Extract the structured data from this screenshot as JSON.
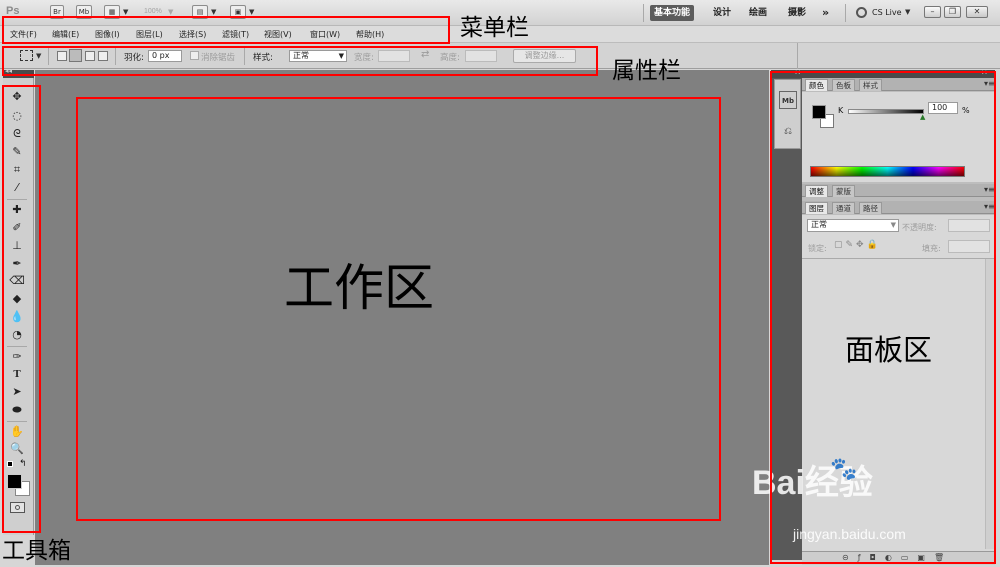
{
  "app": {
    "logo": "Ps",
    "toolbar_buttons": [
      "Br",
      "Mb"
    ],
    "zoom": "100%",
    "workspaces": [
      "基本功能",
      "设计",
      "绘画",
      "摄影"
    ],
    "more": "»",
    "cs_live": "CS Live"
  },
  "menu": [
    "文件(F)",
    "编辑(E)",
    "图像(I)",
    "图层(L)",
    "选择(S)",
    "滤镜(T)",
    "视图(V)",
    "窗口(W)",
    "帮助(H)"
  ],
  "options": {
    "feather_label": "羽化:",
    "feather_value": "0 px",
    "antialias_label": "消除锯齿",
    "style_label": "样式:",
    "style_value": "正常",
    "width_label": "宽度:",
    "height_label": "高度:",
    "refine_edge": "调整边缘..."
  },
  "panels": {
    "group1_tabs": [
      "颜色",
      "色板",
      "样式"
    ],
    "color_channel": "K",
    "color_value": "100",
    "color_unit": "%",
    "group2_tabs": [
      "调整",
      "蒙版"
    ],
    "group3_tabs": [
      "图层",
      "通道",
      "路径"
    ],
    "blend_mode": "正常",
    "opacity_label": "不透明度:",
    "lock_label": "锁定:",
    "fill_label": "填充:"
  },
  "annotations": {
    "menubar": "菜单栏",
    "optionsbar": "属性栏",
    "workarea": "工作区",
    "panelarea": "面板区",
    "toolbox": "工具箱"
  },
  "watermark": {
    "brand": "Bai经验",
    "url": "jingyan.baidu.com"
  },
  "colors": {
    "annotation_box": "#ff0000",
    "workspace_active": "#5c5c5c",
    "canvas": "#808080"
  }
}
